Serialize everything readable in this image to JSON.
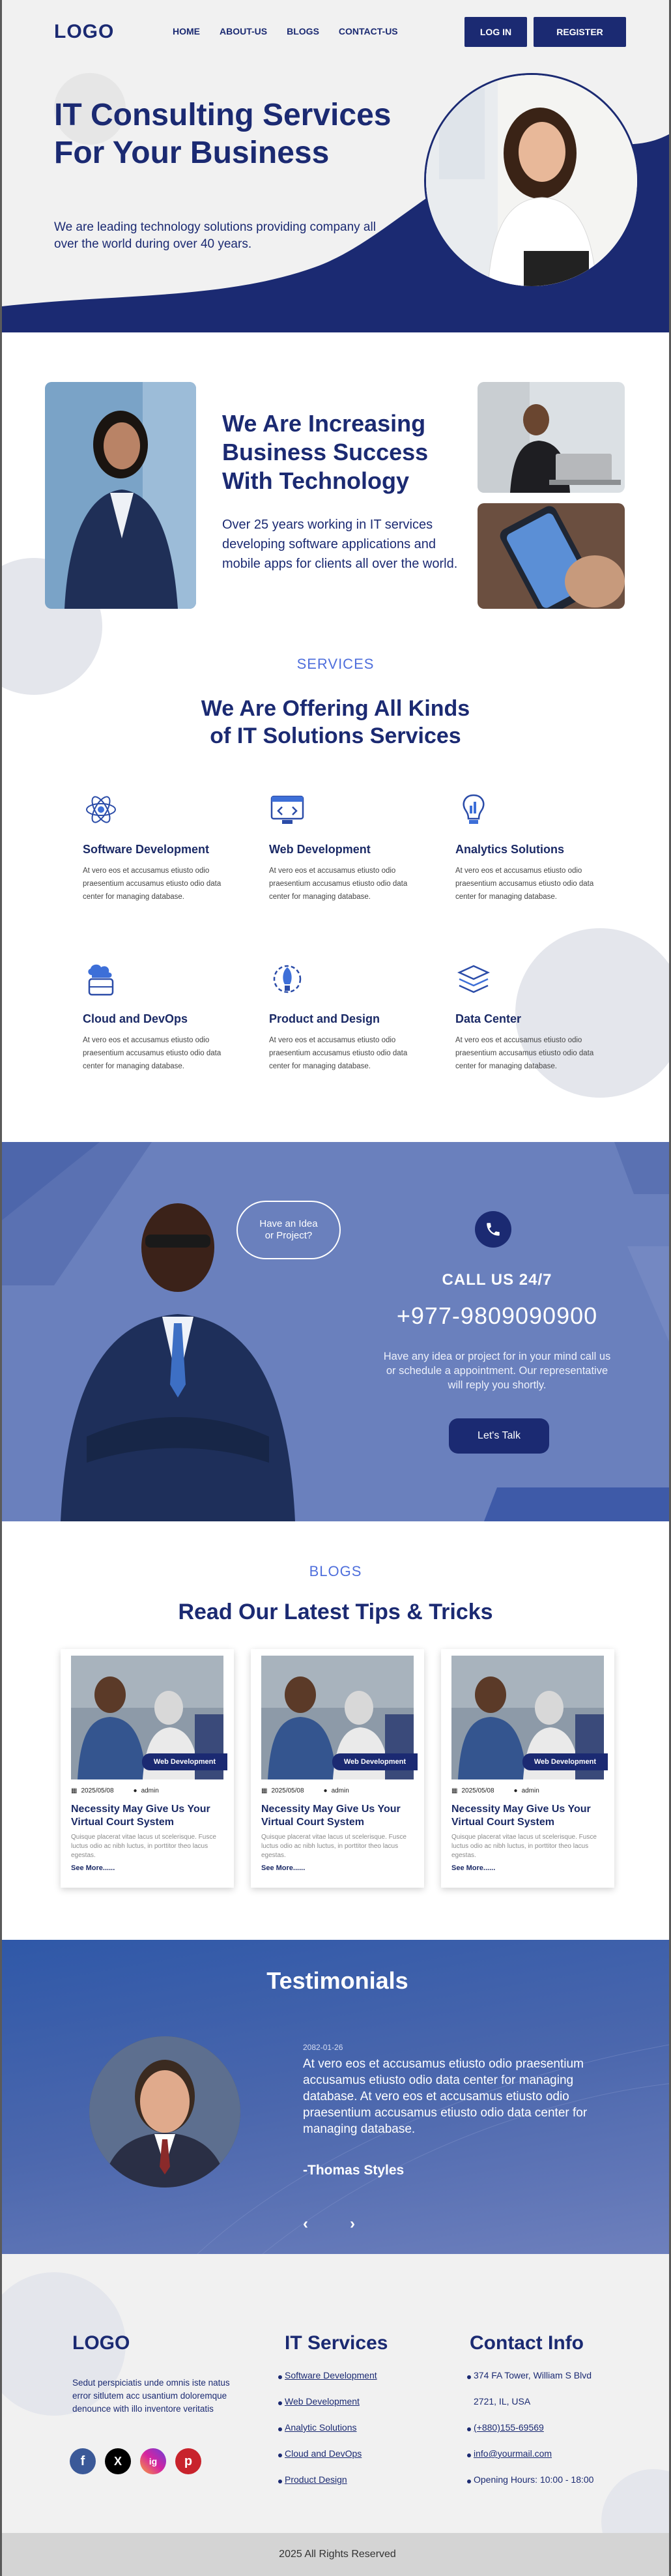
{
  "header": {
    "logo": "LOGO",
    "nav": [
      "HOME",
      "ABOUT-US",
      "BLOGS",
      "CONTACT-US"
    ],
    "login_label": "LOG IN",
    "register_label": "REGISTER"
  },
  "hero": {
    "title": "IT Consulting Services For Your Business",
    "subtitle": "We are leading technology solutions providing company all over the world during over 40 years."
  },
  "about": {
    "title": "We Are Increasing Business Success With Technology",
    "text": "Over 25 years working in IT services developing software applications and mobile apps for clients all over the world."
  },
  "services": {
    "kicker": "SERVICES",
    "title": "We Are Offering All Kinds of IT Solutions Services",
    "items": [
      {
        "title": "Software Development",
        "text": "At vero eos et accusamus etiusto odio praesentium accusamus etiusto odio data center for managing database.",
        "icon": "atom-icon"
      },
      {
        "title": "Web Development",
        "text": "At vero eos et accusamus etiusto odio praesentium accusamus etiusto odio data center for managing database.",
        "icon": "web-code-icon"
      },
      {
        "title": "Analytics Solutions",
        "text": "At vero eos et accusamus etiusto odio praesentium accusamus etiusto odio data center for managing database.",
        "icon": "lightbulb-chart-icon"
      },
      {
        "title": "Cloud and DevOps",
        "text": "At vero eos et accusamus etiusto odio praesentium accusamus etiusto odio data center for managing database.",
        "icon": "cloud-database-icon"
      },
      {
        "title": "Product and Design",
        "text": "At vero eos et accusamus etiusto odio praesentium accusamus etiusto odio data center for managing database.",
        "icon": "rocket-gear-icon"
      },
      {
        "title": "Data Center",
        "text": "At vero eos et accusamus etiusto odio praesentium accusamus etiusto odio data center for managing database.",
        "icon": "server-stack-icon"
      }
    ]
  },
  "cta": {
    "bubble": "Have an Idea or Project?",
    "title": "CALL US 24/7",
    "phone": "+977-9809090900",
    "text": "Have any idea or project for in your mind call us or schedule a appointment. Our representative will reply you shortly.",
    "button": "Let's Talk"
  },
  "blogs": {
    "kicker": "BLOGS",
    "title": "Read Our Latest Tips & Tricks",
    "items": [
      {
        "tag": "Web Development",
        "date": "2025/05/08",
        "author": "admin",
        "title": "Necessity May Give Us Your Virtual Court System",
        "excerpt": "Quisque placerat vitae lacus ut scelerisque. Fusce luctus odio ac nibh luctus, in porttitor theo lacus egestas.",
        "more": "See More......"
      },
      {
        "tag": "Web Development",
        "date": "2025/05/08",
        "author": "admin",
        "title": "Necessity May Give Us Your Virtual Court System",
        "excerpt": "Quisque placerat vitae lacus ut scelerisque. Fusce luctus odio ac nibh luctus, in porttitor theo lacus egestas.",
        "more": "See More......"
      },
      {
        "tag": "Web Development",
        "date": "2025/05/08",
        "author": "admin",
        "title": "Necessity May Give Us Your Virtual Court System",
        "excerpt": "Quisque placerat vitae lacus ut scelerisque. Fusce luctus odio ac nibh luctus, in porttitor theo lacus egestas.",
        "more": "See More......"
      }
    ]
  },
  "testimonials": {
    "title": "Testimonials",
    "date": "2082-01-26",
    "quote": "At vero eos et accusamus etiusto odio praesentium accusamus etiusto odio data center for managing database. At vero eos et accusamus etiusto odio praesentium accusamus etiusto odio data center for managing database.",
    "author": "-Thomas Styles",
    "prev": "‹",
    "next": "›"
  },
  "footer": {
    "logo": "LOGO",
    "desc": "Sedut perspiciatis unde omnis iste natus error sitlutem acc usantium doloremque denounce with illo inventore veritatis",
    "services_title": "IT Services",
    "services": [
      "Software Development",
      "Web Development",
      "Analytic Solutions",
      "Cloud and DevOps",
      "Product Design"
    ],
    "contact_title": "Contact Info",
    "contact": [
      "374 FA Tower, William S Blvd",
      "2721, IL, USA",
      "(+880)155-69569",
      "info@yourmail.com",
      "Opening Hours: 10:00 - 18:00"
    ],
    "social": [
      "f",
      "X",
      "ig",
      "p"
    ],
    "copyright": "2025 All Rights Reserved"
  },
  "colors": {
    "navy": "#1b2a72",
    "accent": "#4f6fdc",
    "cta_bg": "#6a80bd",
    "light_bg": "#f1f1f1"
  }
}
